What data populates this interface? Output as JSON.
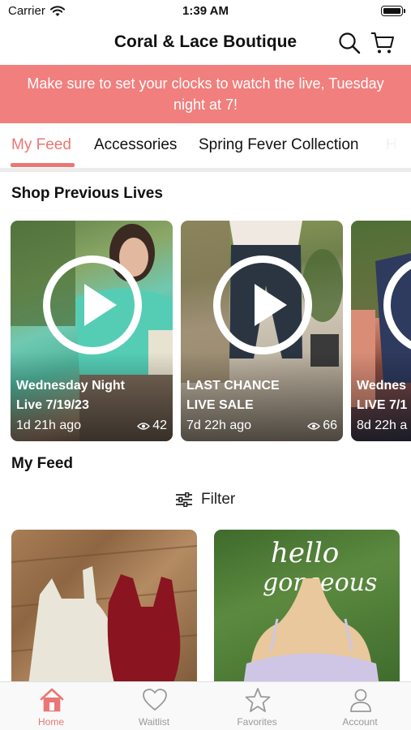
{
  "status_bar": {
    "carrier": "Carrier",
    "time": "1:39 AM"
  },
  "header": {
    "title": "Coral & Lace Boutique"
  },
  "banner": {
    "text": "Make sure to set your clocks to watch the live, Tuesday night at 7!"
  },
  "tabs": [
    {
      "label": "My Feed",
      "active": true
    },
    {
      "label": "Accessories",
      "active": false
    },
    {
      "label": "Spring Fever Collection",
      "active": false
    },
    {
      "label": "H",
      "active": false
    }
  ],
  "lives_section": {
    "title": "Shop Previous Lives",
    "cards": [
      {
        "title_line1": "Wednesday Night",
        "title_line2": "Live 7/19/23",
        "ago": "1d 21h ago",
        "views": "42"
      },
      {
        "title_line1": "LAST CHANCE",
        "title_line2": "LIVE SALE",
        "ago": "7d 22h ago",
        "views": "66"
      },
      {
        "title_line1": "Wednes",
        "title_line2": "LIVE 7/1",
        "ago": "8d 22h a",
        "views": ""
      }
    ]
  },
  "feed_section": {
    "title": "My Feed",
    "filter_label": "Filter"
  },
  "products": [
    {
      "image": "white and burgundy tank bodysuits on wood floor"
    },
    {
      "image": "lavender tank on mannequin with hello gorgeous sign"
    }
  ],
  "bottom_nav": [
    {
      "label": "Home",
      "icon": "home-icon",
      "active": true
    },
    {
      "label": "Waitlist",
      "icon": "heart-icon",
      "active": false
    },
    {
      "label": "Favorites",
      "icon": "star-icon",
      "active": false
    },
    {
      "label": "Account",
      "icon": "person-icon",
      "active": false
    }
  ],
  "colors": {
    "accent": "#E97775",
    "banner_bg": "#F07F7D"
  }
}
